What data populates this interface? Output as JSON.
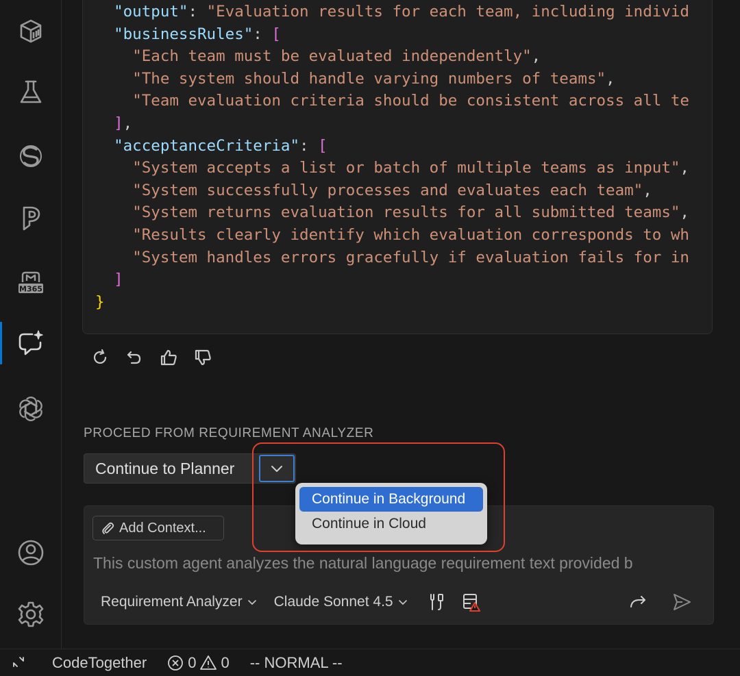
{
  "activity_bar": {
    "items": [
      {
        "name": "package-icon"
      },
      {
        "name": "flask-icon"
      },
      {
        "name": "extension-s-icon"
      },
      {
        "name": "pycharm-p-icon"
      },
      {
        "name": "m365-icon",
        "label": "M365"
      },
      {
        "name": "chat-sparkle-icon",
        "active": true
      },
      {
        "name": "openai-icon"
      },
      {
        "name": "account-icon"
      },
      {
        "name": "settings-gear-icon"
      }
    ]
  },
  "code": {
    "lines": [
      {
        "indent": "  ",
        "parts": [
          {
            "t": "\"output\"",
            "c": "key"
          },
          {
            "t": ": ",
            "c": "pun"
          },
          {
            "t": "\"Evaluation results for each team, including individ",
            "c": "str"
          }
        ]
      },
      {
        "indent": "  ",
        "parts": [
          {
            "t": "\"businessRules\"",
            "c": "key"
          },
          {
            "t": ": ",
            "c": "pun"
          },
          {
            "t": "[",
            "c": "brk"
          }
        ]
      },
      {
        "indent": "    ",
        "parts": [
          {
            "t": "\"Each team must be evaluated independently\"",
            "c": "str"
          },
          {
            "t": ",",
            "c": "pun"
          }
        ]
      },
      {
        "indent": "    ",
        "parts": [
          {
            "t": "\"The system should handle varying numbers of teams\"",
            "c": "str"
          },
          {
            "t": ",",
            "c": "pun"
          }
        ]
      },
      {
        "indent": "    ",
        "parts": [
          {
            "t": "\"Team evaluation criteria should be consistent across all te",
            "c": "str"
          }
        ]
      },
      {
        "indent": "  ",
        "parts": [
          {
            "t": "]",
            "c": "brk"
          },
          {
            "t": ",",
            "c": "pun"
          }
        ]
      },
      {
        "indent": "  ",
        "parts": [
          {
            "t": "\"acceptanceCriteria\"",
            "c": "key"
          },
          {
            "t": ": ",
            "c": "pun"
          },
          {
            "t": "[",
            "c": "brk"
          }
        ]
      },
      {
        "indent": "    ",
        "parts": [
          {
            "t": "\"System accepts a list or batch of multiple teams as input\"",
            "c": "str"
          },
          {
            "t": ",",
            "c": "pun"
          }
        ]
      },
      {
        "indent": "    ",
        "parts": [
          {
            "t": "\"System successfully processes and evaluates each team\"",
            "c": "str"
          },
          {
            "t": ",",
            "c": "pun"
          }
        ]
      },
      {
        "indent": "    ",
        "parts": [
          {
            "t": "\"System returns evaluation results for all submitted teams\"",
            "c": "str"
          },
          {
            "t": ",",
            "c": "pun"
          }
        ]
      },
      {
        "indent": "    ",
        "parts": [
          {
            "t": "\"Results clearly identify which evaluation corresponds to wh",
            "c": "str"
          }
        ]
      },
      {
        "indent": "    ",
        "parts": [
          {
            "t": "\"System handles errors gracefully if evaluation fails for in",
            "c": "str"
          }
        ]
      },
      {
        "indent": "  ",
        "parts": [
          {
            "t": "]",
            "c": "brk"
          }
        ]
      },
      {
        "indent": "",
        "parts": [
          {
            "t": "}",
            "c": "brc"
          }
        ]
      }
    ]
  },
  "response_actions": [
    "refresh-icon",
    "undo-icon",
    "thumbs-up-icon",
    "thumbs-down-icon"
  ],
  "proceed": {
    "label": "PROCEED FROM REQUIREMENT ANALYZER",
    "button_label": "Continue to Planner",
    "menu": [
      {
        "label": "Continue in Background",
        "selected": true
      },
      {
        "label": "Continue in Cloud",
        "selected": false
      }
    ]
  },
  "chat": {
    "add_context_label": "Add Context...",
    "placeholder": "This custom agent analyzes the natural language requirement text provided b",
    "agent_picker": "Requirement Analyzer",
    "model_picker": "Claude Sonnet 4.5"
  },
  "status_bar": {
    "extension": "CodeTogether",
    "errors": "0",
    "warnings": "0",
    "mode": "-- NORMAL --"
  },
  "colors": {
    "accent": "#0078d4",
    "menu_selected": "#2f6ed0",
    "highlight": "#e0412f",
    "string": "#ce9178",
    "key": "#9cdcfe"
  }
}
